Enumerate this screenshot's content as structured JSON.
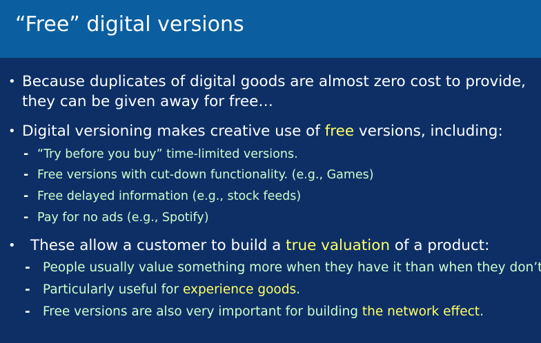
{
  "slide": {
    "title": "“Free” digital versions",
    "bullet_symbol": "•",
    "dash_symbol": "-",
    "bullets": [
      {
        "lines": [
          "Because duplicates of digital goods are almost zero cost to provide,",
          "they can be given away for free…"
        ]
      },
      {
        "text_before": "Digital versioning makes creative use of ",
        "highlight": "free",
        "text_after": " versions, including:",
        "subs": [
          "“Try before you buy” time-limited versions.",
          "Free versions with cut-down functionality. (e.g., Games)",
          "Free delayed information (e.g., stock feeds)",
          "Pay for no ads (e.g., Spotify)"
        ]
      },
      {
        "text_before": "These allow a customer to build a ",
        "highlight": "true valuation",
        "text_after": " of a product:",
        "subs": [
          {
            "text_before": "People usually value something more when they have it than when they don’t.",
            "highlight": "",
            "text_after": ""
          },
          {
            "text_before": "Particularly useful for ",
            "highlight": "experience goods",
            "text_after": "."
          },
          {
            "text_before": "Free versions are also very important for building ",
            "highlight": "the network effect",
            "text_after": "."
          }
        ]
      }
    ]
  },
  "colors": {
    "background": "#0d2f66",
    "title_bar": "#0b5fa0",
    "text": "#ffffff",
    "sub_text": "#ccffcc",
    "highlight": "#ffff66"
  }
}
